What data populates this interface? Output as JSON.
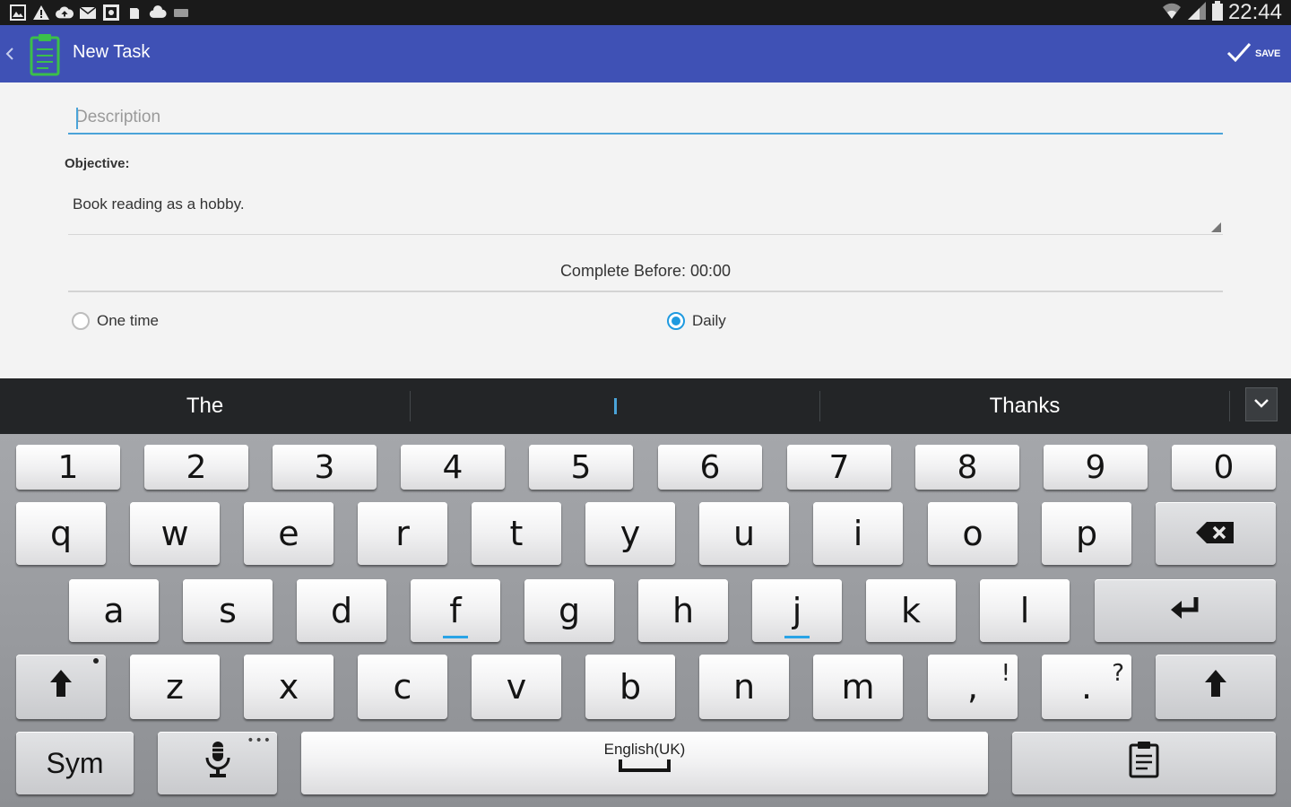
{
  "status_bar": {
    "time": "22:44",
    "left_icons": [
      "gallery-icon",
      "warning-icon",
      "cloud-upload-icon",
      "mail-icon",
      "photo-icon",
      "sim-icon",
      "cloud-icon",
      "keyboard-icon"
    ],
    "right_icons": [
      "wifi-icon",
      "signal-icon",
      "battery-icon"
    ]
  },
  "app_bar": {
    "title": "New Task",
    "save_label": "SAVE",
    "color": "#3f51b5"
  },
  "form": {
    "description_placeholder": "Description",
    "description_value": "",
    "objective_label": "Objective:",
    "objective_text": "Book reading as a hobby.",
    "complete_before": "Complete Before: 00:00",
    "radio_one_time": "One time",
    "radio_daily": "Daily",
    "selected": "daily"
  },
  "suggestions": {
    "left": "The",
    "middle": "",
    "right": "Thanks"
  },
  "keyboard": {
    "number_row": [
      "1",
      "2",
      "3",
      "4",
      "5",
      "6",
      "7",
      "8",
      "9",
      "0"
    ],
    "row1": [
      "q",
      "w",
      "e",
      "r",
      "t",
      "y",
      "u",
      "i",
      "o",
      "p"
    ],
    "row2": [
      "a",
      "s",
      "d",
      "f",
      "g",
      "h",
      "j",
      "k",
      "l"
    ],
    "row3": [
      "z",
      "x",
      "c",
      "v",
      "b",
      "n",
      "m"
    ],
    "comma_key": {
      "main": ",",
      "sub": "!"
    },
    "period_key": {
      "main": ".",
      "sub": "?"
    },
    "sym_label": "Sym",
    "space_label": "English(UK)",
    "accent_color": "#2aa4e6"
  }
}
